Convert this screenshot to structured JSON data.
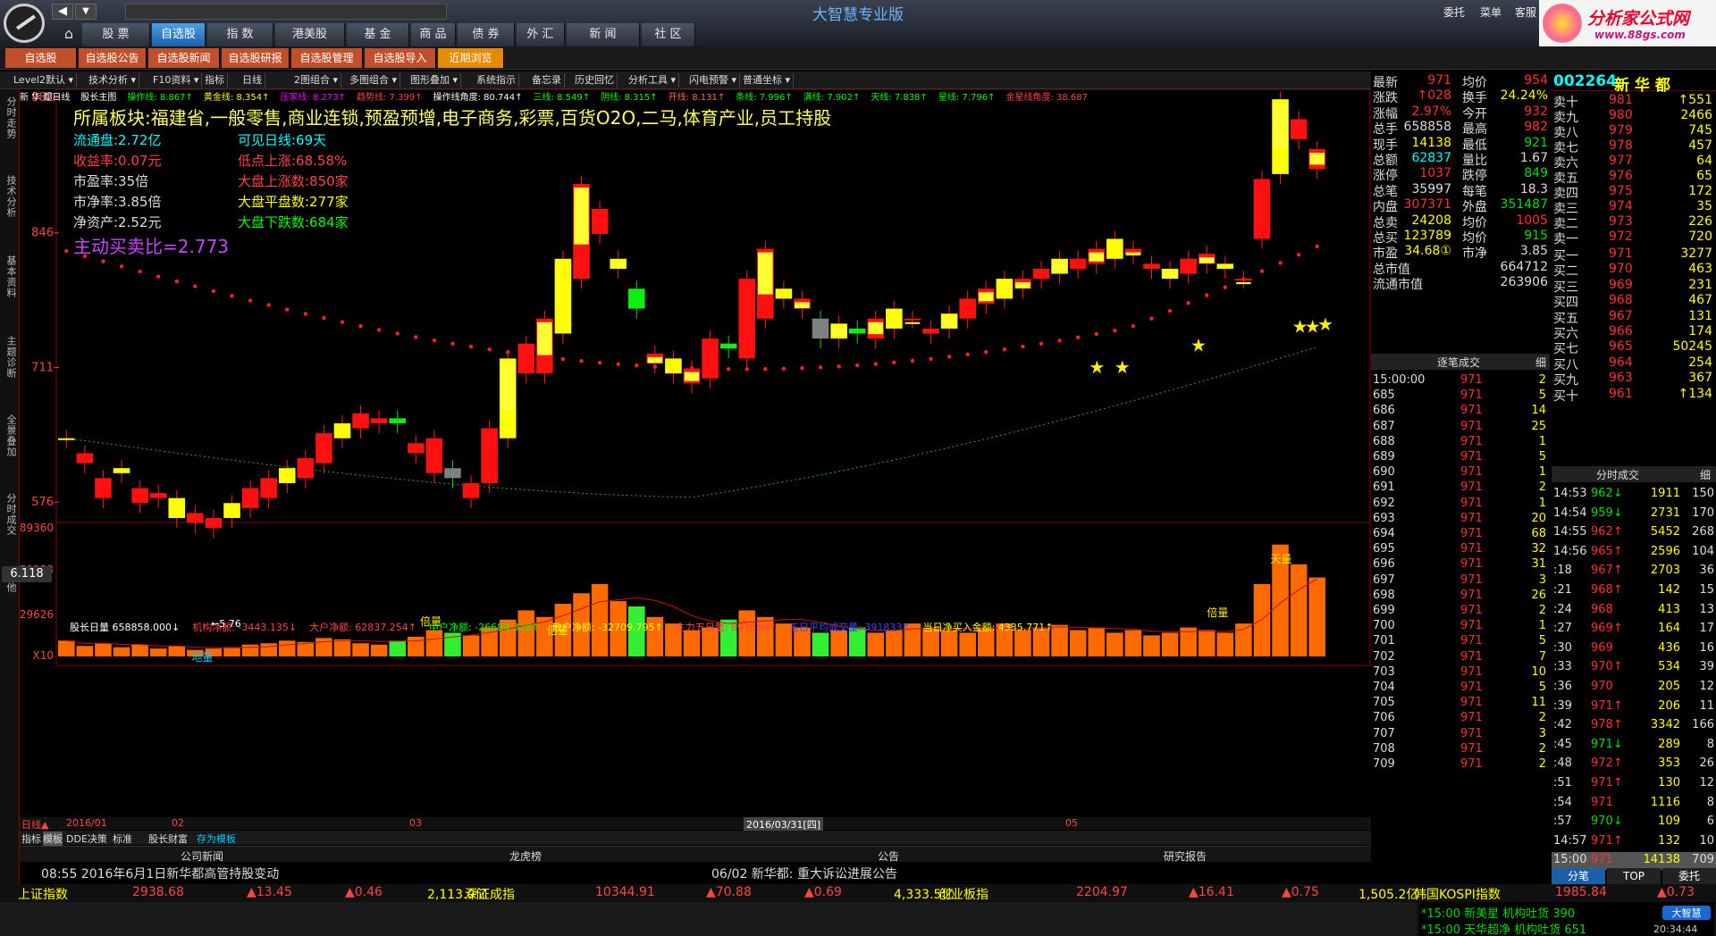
{
  "app": {
    "title": "大智慧专业版",
    "menu": [
      "委托",
      "菜单",
      "客服"
    ],
    "logo_text": "分析家公式网",
    "logo_url": "www.88gs.com"
  },
  "nav": {
    "tabs": [
      "股 票",
      "自选股",
      "指 数",
      "港美股",
      "基 金",
      "商 品",
      "债 券",
      "外 汇",
      "新 闻",
      "社 区"
    ]
  },
  "subtabs": [
    "自选股",
    "自选股公告",
    "自选股新闻",
    "自选股研报",
    "自选股管理",
    "自选股导入",
    "近期浏览"
  ],
  "toolbar": [
    "Level2默认",
    "技术分析",
    "F10资料",
    "指标",
    "日线",
    "2图组合",
    "多图组合",
    "图形叠加",
    "系统指示",
    "备忘录",
    "历史回忆",
    "分析工具",
    "闪电预警",
    "普通坐标"
  ],
  "lefttabs": [
    "分时走势",
    "技术分析",
    "基本资料",
    "主题诊断",
    "全景叠加",
    "分时成交",
    "其他"
  ],
  "chart": {
    "legend": [
      "新 华 都日线",
      "股长主图",
      "操作线: 8.867↑",
      "黄金线: 8.354↑",
      "压家线: 8.273↑",
      "趋势线: 7.399↑",
      "操作线角度: 80.744↑",
      "三线: 8.549↑",
      "阴线: 8.315↑",
      "开线: 8.131↑",
      "条线: 7.996↑",
      "满线: 7.902↑",
      "天线: 7.838↑",
      "星线: 7.796↑",
      "金星线角度: 38.687"
    ],
    "sector": "所属板块:福建省,一般零售,商业连锁,预盈预增,电子商务,彩票,百货O2O,二马,体育产业,员工持股",
    "info_left": [
      "流通盘:2.72亿",
      "收益率:0.07元",
      "市盈率:35倍",
      "市净率:3.85倍",
      "净资产:2.52元"
    ],
    "info_right": [
      "可见日线:69天",
      "低点上涨:68.58%",
      "大盘上涨数:850家",
      "大盘平盘数:277家",
      "大盘下跌数:684家"
    ],
    "ratio": "主动买卖比=2.773",
    "yticks": [
      "982",
      "846",
      "711",
      "576"
    ],
    "current": "6.118",
    "low_label": "←5.76",
    "vol_legend": [
      "股长日量 658858.000↓",
      "机构净额: -3443.135↓",
      "大户净额: 62837.254↑",
      "中户净额: -26684.328↑",
      "散户净额: -32709.795↑",
      "主力五日量: 893648↑",
      "五日平均成交量: 391833↑",
      "当日净买入金额: 4335.771↑"
    ],
    "vol_yticks": [
      "89360",
      "59253",
      "29626",
      "X10"
    ],
    "vol_tags": [
      "天量",
      "地量",
      "倍量",
      "倍量",
      "倍量"
    ],
    "xlabels": [
      "日线▲",
      "2016/01",
      "02",
      "03",
      "2016/03/31[四]",
      "05"
    ]
  },
  "chart_data": {
    "type": "candlestick",
    "prices": [
      [
        640,
        640,
        590,
        560
      ],
      [
        615,
        625,
        575,
        570
      ],
      [
        580,
        600,
        560,
        555
      ],
      [
        605,
        610,
        580,
        570
      ],
      [
        575,
        590,
        570,
        550
      ],
      [
        580,
        585,
        555,
        550
      ],
      [
        560,
        580,
        550,
        540
      ],
      [
        555,
        565,
        545,
        535
      ],
      [
        550,
        560,
        540,
        530
      ],
      [
        560,
        575,
        545,
        540
      ],
      [
        570,
        590,
        560,
        550
      ],
      [
        580,
        600,
        575,
        570
      ],
      [
        595,
        610,
        580,
        575
      ],
      [
        600,
        620,
        595,
        590
      ],
      [
        615,
        645,
        610,
        600
      ],
      [
        640,
        655,
        625,
        615
      ],
      [
        650,
        665,
        640,
        630
      ],
      [
        655,
        660,
        640,
        625
      ],
      [
        660,
        655,
        610,
        605
      ],
      [
        625,
        635,
        600,
        590
      ],
      [
        605,
        640,
        585,
        580
      ],
      [
        610,
        600,
        560,
        550
      ],
      [
        580,
        595,
        560,
        545
      ],
      [
        595,
        650,
        590,
        585
      ],
      [
        640,
        720,
        640,
        635
      ],
      [
        705,
        735,
        695,
        690
      ],
      [
        705,
        760,
        700,
        690
      ],
      [
        745,
        820,
        740,
        735
      ],
      [
        800,
        895,
        780,
        770
      ],
      [
        845,
        870,
        810,
        800
      ],
      [
        810,
        820,
        770,
        760
      ],
      [
        790,
        770,
        700,
        690
      ],
      [
        715,
        725,
        690,
        680
      ],
      [
        705,
        720,
        690,
        680
      ],
      [
        695,
        710,
        680,
        670
      ],
      [
        700,
        740,
        690,
        680
      ],
      [
        735,
        730,
        705,
        700
      ],
      [
        720,
        800,
        715,
        705
      ],
      [
        760,
        830,
        750,
        745
      ],
      [
        780,
        790,
        760,
        750
      ],
      [
        770,
        780,
        745,
        740
      ],
      [
        760,
        740,
        730,
        725
      ],
      [
        740,
        755,
        720,
        715
      ],
      [
        750,
        745,
        725,
        720
      ],
      [
        740,
        760,
        735,
        730
      ],
      [
        750,
        770,
        745,
        740
      ],
      [
        760,
        760,
        740,
        735
      ],
      [
        745,
        750,
        730,
        725
      ],
      [
        750,
        765,
        745,
        740
      ],
      [
        760,
        780,
        755,
        750
      ],
      [
        775,
        790,
        770,
        765
      ],
      [
        780,
        800,
        775,
        770
      ],
      [
        790,
        800,
        780,
        775
      ],
      [
        800,
        810,
        790,
        785
      ],
      [
        805,
        820,
        800,
        795
      ],
      [
        810,
        820,
        800,
        795
      ],
      [
        815,
        830,
        810,
        805
      ],
      [
        820,
        840,
        815,
        810
      ],
      [
        825,
        830,
        805,
        800
      ],
      [
        810,
        815,
        795,
        790
      ],
      [
        800,
        810,
        790,
        785
      ],
      [
        805,
        820,
        800,
        795
      ],
      [
        815,
        825,
        805,
        800
      ],
      [
        810,
        815,
        795,
        790
      ],
      [
        800,
        800,
        720,
        700
      ],
      [
        840,
        900,
        820,
        810
      ],
      [
        905,
        980,
        900,
        880
      ],
      [
        940,
        960,
        880,
        870
      ],
      [
        910,
        930,
        860,
        850
      ]
    ],
    "volume": [
      12,
      8,
      10,
      7,
      9,
      6,
      8,
      5,
      6,
      7,
      9,
      10,
      12,
      11,
      14,
      13,
      10,
      9,
      12,
      15,
      20,
      18,
      16,
      22,
      28,
      35,
      30,
      40,
      48,
      55,
      42,
      38,
      30,
      25,
      20,
      22,
      28,
      35,
      30,
      25,
      22,
      18,
      20,
      22,
      18,
      20,
      25,
      22,
      20,
      18,
      22,
      25,
      20,
      22,
      24,
      20,
      22,
      18,
      20,
      16,
      18,
      22,
      20,
      18,
      25,
      55,
      85,
      70,
      60
    ]
  },
  "quote": {
    "code": "002264",
    "name": "新 华 都",
    "rows": [
      [
        "最新",
        "971",
        "均价",
        "954"
      ],
      [
        "涨跌",
        "↑028",
        "换手",
        "24.24%"
      ],
      [
        "涨幅",
        "2.97%",
        "今开",
        "932"
      ],
      [
        "总手",
        "658858",
        "最高",
        "982"
      ],
      [
        "现手",
        "14138",
        "最低",
        "921"
      ],
      [
        "总额",
        "62837",
        "量比",
        "1.67"
      ],
      [
        "涨停",
        "1037",
        "跌停",
        "849"
      ],
      [
        "总笔",
        "35997",
        "每笔",
        "18.3"
      ],
      [
        "内盘",
        "307371",
        "外盘",
        "351487"
      ],
      [
        "总卖",
        "24208",
        "均价",
        "1005"
      ],
      [
        "总买",
        "123789",
        "均价",
        "915"
      ],
      [
        "市盈",
        "34.68①",
        "市净",
        "3.85"
      ],
      [
        "总市值",
        "",
        "",
        "664712"
      ],
      [
        "流通市值",
        "",
        "",
        "263906"
      ]
    ],
    "asks": [
      [
        "卖十",
        "981",
        "↑551"
      ],
      [
        "卖九",
        "980",
        "2466"
      ],
      [
        "卖八",
        "979",
        "745"
      ],
      [
        "卖七",
        "978",
        "457"
      ],
      [
        "卖六",
        "977",
        "64"
      ],
      [
        "卖五",
        "976",
        "65"
      ],
      [
        "卖四",
        "975",
        "172"
      ],
      [
        "卖三",
        "974",
        "35"
      ],
      [
        "卖二",
        "973",
        "226"
      ],
      [
        "卖一",
        "972",
        "720"
      ]
    ],
    "bids": [
      [
        "买一",
        "971",
        "3277"
      ],
      [
        "买二",
        "970",
        "463"
      ],
      [
        "买三",
        "969",
        "231"
      ],
      [
        "买四",
        "968",
        "467"
      ],
      [
        "买五",
        "967",
        "131"
      ],
      [
        "买六",
        "966",
        "174"
      ],
      [
        "买七",
        "965",
        "50245"
      ],
      [
        "买八",
        "964",
        "254"
      ],
      [
        "买九",
        "963",
        "367"
      ],
      [
        "买十",
        "961",
        "↑134"
      ]
    ],
    "ticks_title": "逐笔成交",
    "ticks_title_btn": "细",
    "ticks": [
      [
        "15:00:00",
        "971",
        "2"
      ],
      [
        "685",
        "971",
        "5"
      ],
      [
        "686",
        "971",
        "14"
      ],
      [
        "687",
        "971",
        "25"
      ],
      [
        "688",
        "971",
        "1"
      ],
      [
        "689",
        "971",
        "5"
      ],
      [
        "690",
        "971",
        "1"
      ],
      [
        "691",
        "971",
        "2"
      ],
      [
        "692",
        "971",
        "1"
      ],
      [
        "693",
        "971",
        "20"
      ],
      [
        "694",
        "971",
        "68"
      ],
      [
        "695",
        "971",
        "32"
      ],
      [
        "696",
        "971",
        "31"
      ],
      [
        "697",
        "971",
        "3"
      ],
      [
        "698",
        "971",
        "26"
      ],
      [
        "699",
        "971",
        "2"
      ],
      [
        "700",
        "971",
        "1"
      ],
      [
        "701",
        "971",
        "5"
      ],
      [
        "702",
        "971",
        "7"
      ],
      [
        "703",
        "971",
        "10"
      ],
      [
        "704",
        "971",
        "5"
      ],
      [
        "705",
        "971",
        "11"
      ],
      [
        "706",
        "971",
        "2"
      ],
      [
        "707",
        "971",
        "3"
      ],
      [
        "708",
        "971",
        "2"
      ],
      [
        "709",
        "971",
        "2"
      ]
    ],
    "min_title": "分时成交",
    "min_title_btn": "细",
    "mins": [
      [
        "14:53",
        "962↓",
        "1911",
        "150"
      ],
      [
        "14:54",
        "959↓",
        "2731",
        "170"
      ],
      [
        "14:55",
        "962↑",
        "5452",
        "268"
      ],
      [
        "14:56",
        "965↑",
        "2596",
        "104"
      ],
      [
        ":18",
        "967↑",
        "2703",
        "36"
      ],
      [
        ":21",
        "968↑",
        "142",
        "15"
      ],
      [
        ":24",
        "968",
        "413",
        "13"
      ],
      [
        ":27",
        "969↑",
        "164",
        "17"
      ],
      [
        ":30",
        "969",
        "436",
        "16"
      ],
      [
        ":33",
        "970↑",
        "534",
        "39"
      ],
      [
        ":36",
        "970",
        "205",
        "12"
      ],
      [
        ":39",
        "971↑",
        "206",
        "11"
      ],
      [
        ":42",
        "978↑",
        "3342",
        "166"
      ],
      [
        ":45",
        "971↓",
        "289",
        "8"
      ],
      [
        ":48",
        "972↑",
        "353",
        "26"
      ],
      [
        ":51",
        "971↑",
        "130",
        "12"
      ],
      [
        ":54",
        "971",
        "1116",
        "8"
      ],
      [
        ":57",
        "970↓",
        "109",
        "6"
      ],
      [
        "14:57",
        "971↑",
        "132",
        "10"
      ],
      [
        "15:00",
        "971",
        "14138",
        "709"
      ]
    ],
    "tabs_bottom": [
      "分笔",
      "TOP",
      "委托"
    ]
  },
  "bottom": {
    "news_tabs": [
      "指标",
      "模板",
      "DDE决策",
      "标准",
      "股长财富",
      "存为模板"
    ],
    "cols": [
      "公司新闻",
      "龙虎榜",
      "公告",
      "研究报告"
    ],
    "news": [
      "08:55  2016年6月1日新华都高管持股变动",
      "06/02 新华都: 重大诉讼进展公告"
    ],
    "indices": [
      [
        "上证指数",
        "2938.68",
        "▲13.45",
        "▲0.46",
        "2,113.0亿"
      ],
      [
        "深证成指",
        "10344.91",
        "▲70.88",
        "▲0.69",
        "4,333.5亿"
      ],
      [
        "创业板指",
        "2204.97",
        "▲16.41",
        "▲0.75",
        "1,505.2亿"
      ],
      [
        "韩国KOSPI指数",
        "1985.84",
        "▲0.73"
      ]
    ],
    "alerts": [
      "*15:00  新美星  机构吐货  390",
      "*15:00  天华超净  机构吐货  651"
    ],
    "time": "20:34:44"
  }
}
